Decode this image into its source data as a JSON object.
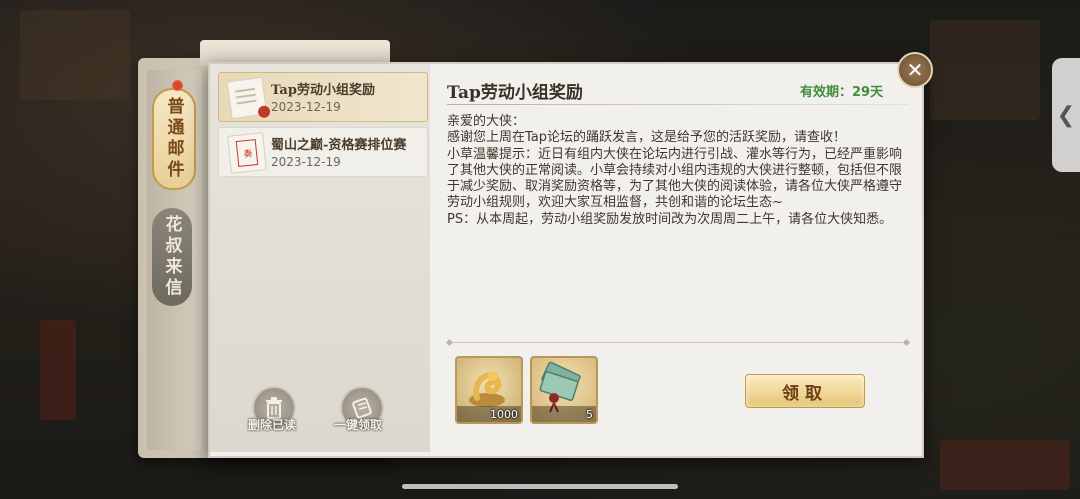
{
  "tabs": [
    {
      "label": "普通邮件",
      "active": true
    },
    {
      "label": "花叔来信",
      "active": false
    }
  ],
  "mail_list": [
    {
      "title": "Tap劳动小组奖励",
      "date": "2023-12-19",
      "selected": true
    },
    {
      "title": "蜀山之巅-资格赛排位赛",
      "date": "2023-12-19",
      "selected": false
    }
  ],
  "bottom_actions": {
    "delete_read_label": "删除已读",
    "claim_all_label": "一键领取"
  },
  "mail": {
    "title": "Tap劳动小组奖励",
    "validity": "有效期：29天",
    "body": "亲爱的大侠：\n感谢您上周在Tap论坛的踊跃发言，这是给予您的活跃奖励，请查收！\n小草温馨提示：近日有组内大侠在论坛内进行引战、灌水等行为，已经严重影响了其他大侠的正常阅读。小草会持续对小组内违规的大侠进行整顿，包括但不限于减少奖励、取消奖励资格等，为了其他大侠的阅读体验，请各位大侠严格遵守劳动小组规则，欢迎大家互相监督，共创和谐的论坛生态~\nPS：从本周起，劳动小组奖励发放时间改为次周周二上午，请各位大侠知悉。"
  },
  "rewards": [
    {
      "icon": "gold-dragon-icon",
      "count": "1000"
    },
    {
      "icon": "banknote-bundle-icon",
      "count": "5"
    }
  ],
  "claim_label": "领取",
  "close_symbol": "✕",
  "side_handle_symbol": "❮",
  "colors": {
    "accent_gold": "#e6c373",
    "validity_green": "#3f8f3a",
    "unread_dot": "#e0452b"
  }
}
